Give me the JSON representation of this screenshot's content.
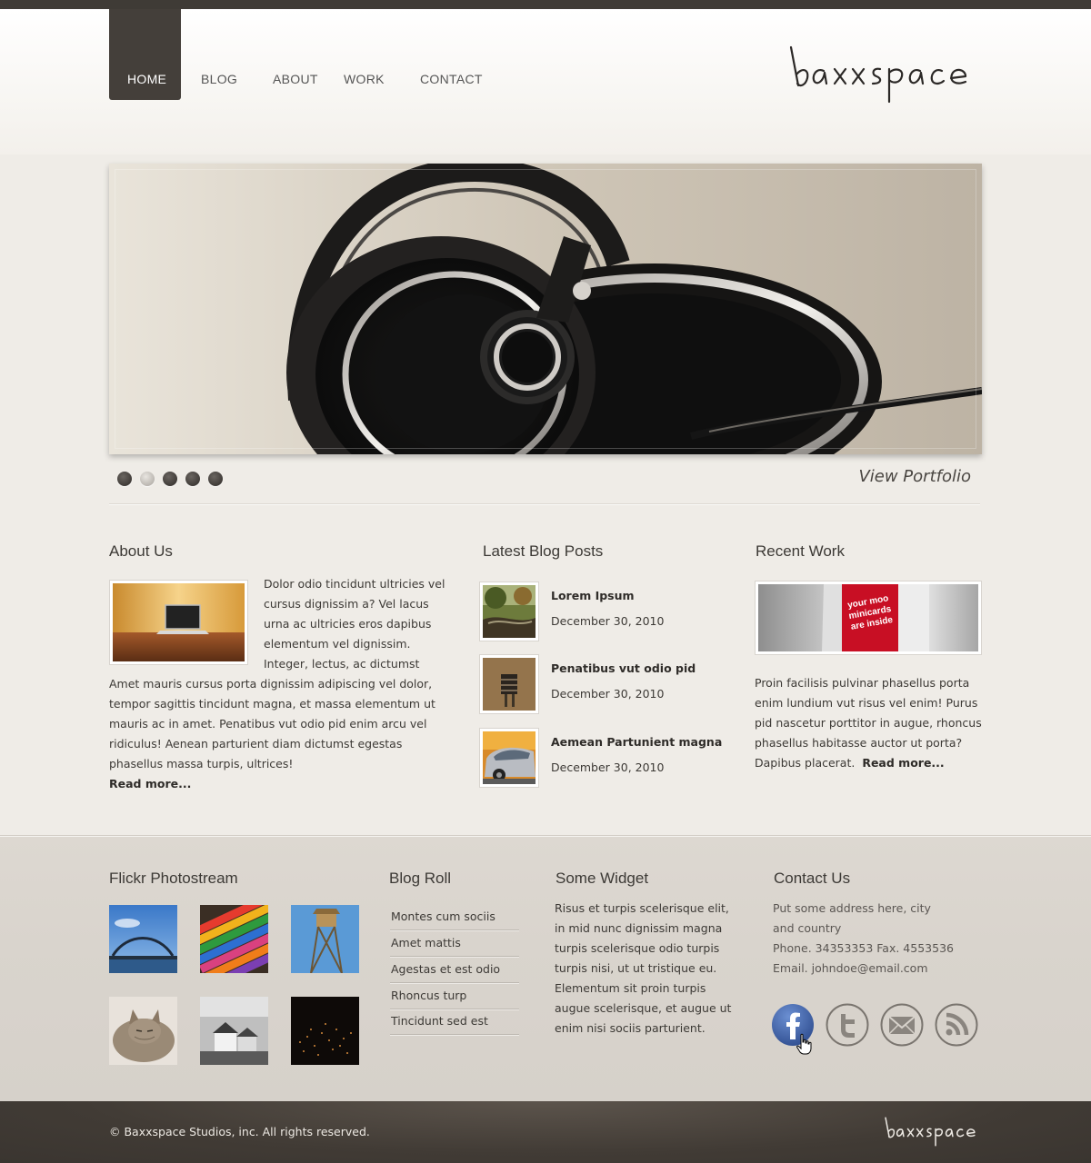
{
  "nav": {
    "items": [
      {
        "label": "HOME",
        "active": true
      },
      {
        "label": "BLOG"
      },
      {
        "label": "ABOUT"
      },
      {
        "label": "WORK"
      },
      {
        "label": "CONTACT"
      }
    ]
  },
  "logo": {
    "text": "baxxspace"
  },
  "slider": {
    "image": "headphones-photo",
    "dots": {
      "count": 5,
      "active_index": 1
    },
    "view_portfolio": "View Portfolio"
  },
  "about": {
    "title": "About Us",
    "thumb": "laptop-on-table-photo",
    "body": "Dolor odio tincidunt ultricies vel cursus dignissim a? Vel lacus urna ac ultricies eros dapibus elementum vel dignissim. Integer, lectus, ac dictumst Amet mauris cursus porta dignissim adipiscing vel dolor, tempor sagittis tincidunt magna, et massa elementum ut mauris ac in amet. Penatibus vut odio pid enim arcu vel ridiculus! Aenean parturient diam dictumst egestas phasellus massa turpis, ultrices!",
    "read_more": "Read more..."
  },
  "blog": {
    "title": "Latest Blog Posts",
    "posts": [
      {
        "title": "Lorem Ipsum",
        "date": "December 30, 2010",
        "thumb": "garden-stream-photo"
      },
      {
        "title": "Penatibus vut odio pid",
        "date": "December 30, 2010",
        "thumb": "wall-vent-photo"
      },
      {
        "title": "Aemean Partunient magna",
        "date": "December 30, 2010",
        "thumb": "silver-car-photo"
      }
    ]
  },
  "work": {
    "title": "Recent Work",
    "thumb": "moo-minicards-box-photo",
    "thumb_label_lines": [
      "your moo",
      "minicards",
      "are inside"
    ],
    "body": "Proin facilisis pulvinar phasellus porta enim lundium vut risus vel enim! Purus pid nascetur porttitor in augue, rhoncus phasellus habitasse auctor ut porta? Dapibus placerat.",
    "read_more": "Read more..."
  },
  "flickr": {
    "title": "Flickr Photostream",
    "images": [
      "harbour-bridge-photo",
      "crayons-photo",
      "tower-photo",
      "cat-photo",
      "houses-bw-photo",
      "night-city-photo"
    ]
  },
  "blogroll": {
    "title": "Blog Roll",
    "items": [
      "Montes cum sociis",
      "Amet mattis",
      "Agestas et est odio",
      "Rhoncus turp",
      "Tincidunt sed est"
    ]
  },
  "widget": {
    "title": "Some Widget",
    "body": "Risus et turpis scelerisque elit, in mid nunc dignissim magna turpis scelerisque odio turpis turpis nisi, ut ut tristique eu. Elementum sit proin turpis augue scelerisque, et augue ut enim nisi sociis parturient."
  },
  "contact": {
    "title": "Contact Us",
    "lines": [
      "Put some address here, city",
      "and country",
      "Phone. 34353353 Fax. 4553536",
      "Email. johndoe@email.com"
    ],
    "social": [
      "facebook-icon",
      "twitter-icon",
      "email-icon",
      "rss-icon"
    ]
  },
  "footer": {
    "copyright": "© Baxxspace Studios, inc. All rights reserved.",
    "logo": "baxxspace"
  },
  "colors": {
    "background": "#efece7",
    "nav_active": "#443f3a",
    "footer_dark": "#413b35",
    "facebook": "#3b5998"
  }
}
